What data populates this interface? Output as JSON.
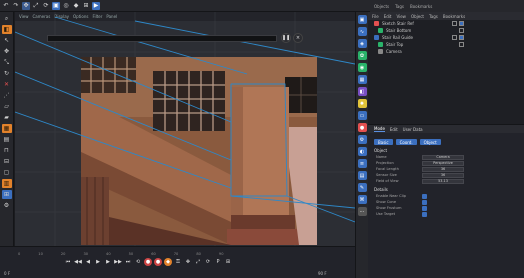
{
  "toolbar": {
    "icons": [
      "undo-icon",
      "redo-icon",
      "move-icon",
      "scale-icon",
      "rotate-icon",
      "select-icon",
      "live-select-icon",
      "mode-icon"
    ]
  },
  "menu": {
    "items": [
      "Objects",
      "Tags",
      "Bookmarks"
    ]
  },
  "viewport": {
    "header_items": [
      "View",
      "Cameras",
      "Display",
      "Options",
      "Filter",
      "Panel"
    ]
  },
  "objects": {
    "header": [
      "File",
      "Edit",
      "View",
      "Object",
      "Tags",
      "Bookmarks"
    ],
    "rows": [
      {
        "label": "Sketch Stair Ref",
        "color": "#e35050"
      },
      {
        "label": "Stair Bottom",
        "color": "#2ab36a"
      },
      {
        "label": "Stair Rail Guide",
        "color": "#3b6fbf"
      },
      {
        "label": "Stair Top",
        "color": "#2ab36a"
      },
      {
        "label": "Camera",
        "color": "#888888"
      }
    ]
  },
  "attributes": {
    "tabs": [
      "Mode",
      "Edit",
      "User Data"
    ],
    "buttons": [
      "Basic",
      "Coord.",
      "Object"
    ],
    "section_object": "Object",
    "props": [
      {
        "label": "Name",
        "value": "Camera"
      },
      {
        "label": "Projection",
        "value": "Perspective"
      },
      {
        "label": "Focal Length",
        "value": "36"
      },
      {
        "label": "Sensor Size",
        "value": "36"
      },
      {
        "label": "Field of View",
        "value": "53.13"
      }
    ],
    "section_details": "Details",
    "checks": [
      "Enable Near Clip",
      "Show Cone",
      "Show Frustum",
      "Use Target"
    ]
  },
  "timeline": {
    "ruler": [
      "0",
      "10",
      "20",
      "30",
      "40",
      "50",
      "60",
      "70",
      "80",
      "90"
    ],
    "start_frame": "0 F",
    "end_frame": "90 F"
  },
  "colors": {
    "accent": "#3b6fbf",
    "orange": "#e2822b",
    "record": "#cc4444"
  }
}
